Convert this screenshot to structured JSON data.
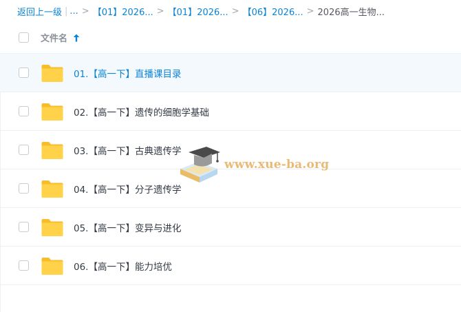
{
  "breadcrumb": {
    "back_label": "返回上一级",
    "ellipsis": "...",
    "items": [
      {
        "label": "【01】2026..."
      },
      {
        "label": "【01】2026..."
      },
      {
        "label": "【06】2026..."
      }
    ],
    "current": "2026高一生物...",
    "separator": ">",
    "pipe": "|"
  },
  "list_header": {
    "name_column": "文件名"
  },
  "files": [
    {
      "name": "01.【高一下】直播课目录",
      "type": "folder",
      "selected": true
    },
    {
      "name": "02.【高一下】遗传的细胞学基础",
      "type": "folder",
      "selected": false
    },
    {
      "name": "03.【高一下】古典遗传学",
      "type": "folder",
      "selected": false
    },
    {
      "name": "04.【高一下】分子遗传学",
      "type": "folder",
      "selected": false
    },
    {
      "name": "05.【高一下】变异与进化",
      "type": "folder",
      "selected": false
    },
    {
      "name": "06.【高一下】能力培优",
      "type": "folder",
      "selected": false
    }
  ],
  "watermark": {
    "text": "www.xue-ba.org"
  },
  "colors": {
    "accent": "#0a84d8",
    "folder": "#ffd24a",
    "selected_row": "#f4f9fe",
    "watermark": "#e9b56a"
  },
  "icons": {
    "sort": "arrow-up-icon",
    "folder": "folder-icon",
    "watermark": "graduation-cap-icon"
  }
}
